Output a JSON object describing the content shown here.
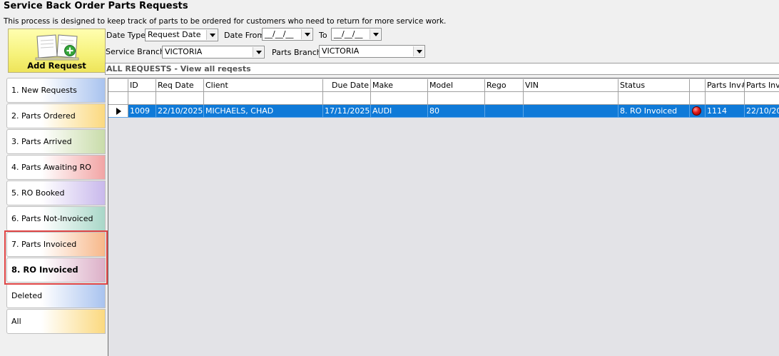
{
  "window": {
    "title": "Service Back Order Parts Requests",
    "subtitle": "This process is designed to keep track of parts to be ordered for customers who need to return for more service work."
  },
  "add_button": {
    "label": "Add Request",
    "icon": "book-add-icon"
  },
  "filters": {
    "date_type": {
      "label": "Date Type",
      "value": "Request Date"
    },
    "date_from": {
      "label": "Date From",
      "value": "__/__/__"
    },
    "date_to": {
      "label": "To",
      "value": "__/__/__"
    },
    "service_branch": {
      "label": "Service Branch",
      "value": "VICTORIA"
    },
    "parts_branch": {
      "label": "Parts Branch",
      "value": "VICTORIA"
    }
  },
  "view_header": {
    "text": "ALL REQUESTS - View all reqests"
  },
  "sidebar": {
    "items": [
      {
        "label": "1. New Requests",
        "color": "#a9c3ef"
      },
      {
        "label": "2. Parts Ordered",
        "color": "#fbd97f"
      },
      {
        "label": "3. Parts Arrived",
        "color": "#c9dcaa"
      },
      {
        "label": "4. Parts Awaiting RO",
        "color": "#f2a5a5"
      },
      {
        "label": "5. RO Booked",
        "color": "#c9b9ec"
      },
      {
        "label": "6. Parts Not-Invoiced",
        "color": "#a9d7c8"
      },
      {
        "label": "7. Parts Invoiced",
        "color": "#f7b88a"
      },
      {
        "label": "8. RO Invoiced",
        "color": "#dcb0c8"
      },
      {
        "label": "Deleted",
        "color": "#a9c3ef"
      },
      {
        "label": "All",
        "color": "#fbd97f"
      }
    ]
  },
  "grid": {
    "columns": [
      "ID",
      "Req Date",
      "Client",
      "Due Date",
      "Make",
      "Model",
      "Rego",
      "VIN",
      "Status",
      "",
      "Parts Inv#",
      "Parts Inv"
    ],
    "rows": [
      {
        "id": "1009",
        "req_date": "22/10/2025",
        "client": "MICHAELS, CHAD",
        "due_date": "17/11/2025",
        "make": "AUDI",
        "model": "80",
        "rego": "",
        "vin": "",
        "status": "8. RO Invoiced",
        "status_icon": "red-dot-icon",
        "parts_inv_no": "1114",
        "parts_inv": "22/10/20"
      }
    ]
  }
}
